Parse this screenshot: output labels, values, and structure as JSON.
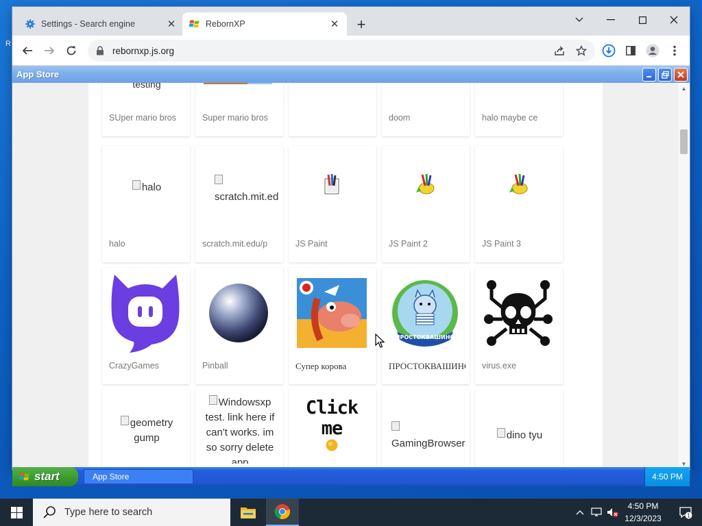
{
  "browser": {
    "tabs": [
      {
        "title": "Settings - Search engine",
        "active": false
      },
      {
        "title": "RebornXP",
        "active": true
      }
    ],
    "url": "rebornxp.js.org"
  },
  "xp_window": {
    "title": "App Store"
  },
  "apps": {
    "row1": [
      "SUper mario bros",
      "Super mario bros",
      "",
      "doom",
      "halo maybe ce"
    ],
    "row1_partial_text": "testing",
    "row2": [
      {
        "label": "halo",
        "alt": "halo"
      },
      {
        "label": "scratch.mit.edu/p",
        "alt": "scratch.mit.edu/"
      },
      {
        "label": "JS Paint"
      },
      {
        "label": "JS Paint 2"
      },
      {
        "label": "JS Paint 3"
      }
    ],
    "row3": [
      "CrazyGames",
      "Pinball",
      "Супер корова",
      "ПРОСТОКВАШИНО",
      "virus.exe"
    ],
    "row4": [
      {
        "alt": "geometry gump"
      },
      {
        "alt": "Windowsxp test. link here if can't works. im so sorry delete app"
      },
      {
        "image_text": "Click me"
      },
      {
        "alt": "GamingBrowser"
      },
      {
        "alt": "dino tyu"
      }
    ]
  },
  "xp_taskbar": {
    "start_label": "start",
    "task_button": "App Store",
    "clock": "4:50 PM"
  },
  "windows_taskbar": {
    "search_placeholder": "Type here to search",
    "time": "4:50 PM",
    "date": "12/3/2023",
    "notification_count": "1"
  }
}
